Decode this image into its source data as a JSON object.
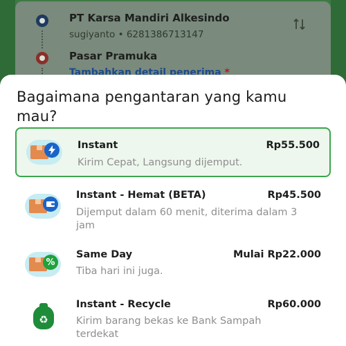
{
  "address": {
    "origin_name": "PT Karsa Mandiri Alkesindo",
    "origin_contact": "sugiyanto • 6281386713147",
    "destination_name": "Pasar Pramuka",
    "add_recipient_link": "Tambahkan detail penerima",
    "required_mark": "*",
    "swap_icon": "swap-vertical-icon"
  },
  "sheet": {
    "title": "Bagaimana pengantaran yang kamu mau?"
  },
  "options": [
    {
      "name": "Instant",
      "price": "Rp55.500",
      "description": "Kirim Cepat, Langsung dijemput.",
      "icon": "lightning-icon",
      "selected": true
    },
    {
      "name": "Instant - Hemat (BETA)",
      "price": "Rp45.500",
      "description": "Dijemput dalam 60 menit, diterima dalam 3 jam",
      "icon": "wallet-icon",
      "selected": false
    },
    {
      "name": "Same Day",
      "price": "Mulai Rp22.000",
      "description": "Tiba hari ini juga.",
      "icon": "percent-icon",
      "selected": false
    },
    {
      "name": "Instant - Recycle",
      "price": "Rp60.000",
      "description": "Kirim barang bekas ke Bank Sampah terdekat",
      "icon": "recycle-bag-icon",
      "selected": false
    }
  ],
  "colors": {
    "selected_border": "#3aa64c",
    "selected_bg": "#eef7ee",
    "link_blue": "#1c4a8a",
    "required_red": "#a3241d"
  }
}
